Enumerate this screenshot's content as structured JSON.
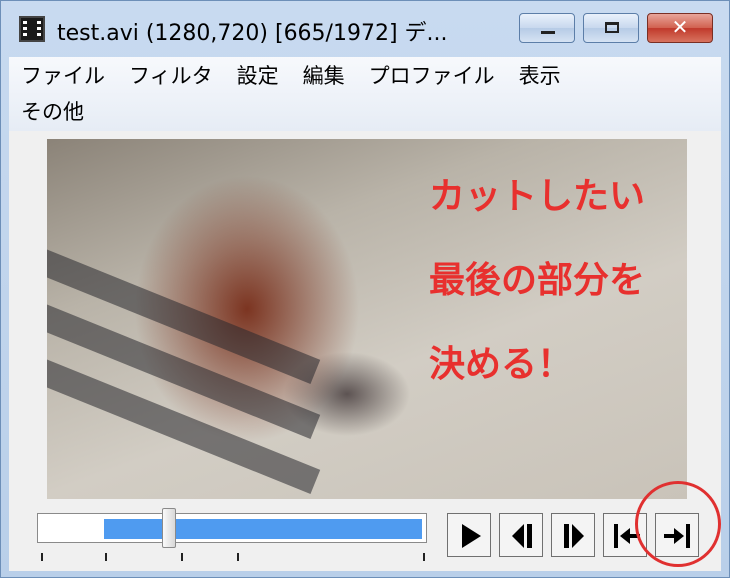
{
  "window": {
    "title": "test.avi (1280,720)  [665/1972]  デ...",
    "close_symbol": "✕",
    "icon": "film-icon"
  },
  "menu": {
    "row1": [
      "ファイル",
      "フィルタ",
      "設定",
      "編集",
      "プロファイル",
      "表示"
    ],
    "row2": [
      "その他"
    ]
  },
  "video": {
    "overlay_lines": [
      "カットしたい",
      "最後の部分を",
      "決める！"
    ],
    "overlay_color": "#e8302e"
  },
  "seek": {
    "current_frame": 665,
    "total_frames": 1972,
    "selection_color": "#4f9bf0"
  },
  "controls": [
    {
      "name": "play-button",
      "icon": "play-icon"
    },
    {
      "name": "prev-frame-button",
      "icon": "prev-frame-icon"
    },
    {
      "name": "next-frame-button",
      "icon": "next-frame-icon"
    },
    {
      "name": "set-start-button",
      "icon": "set-start-icon"
    },
    {
      "name": "set-end-button",
      "icon": "set-end-icon"
    }
  ],
  "annotation": {
    "highlight_color": "#e03030"
  }
}
